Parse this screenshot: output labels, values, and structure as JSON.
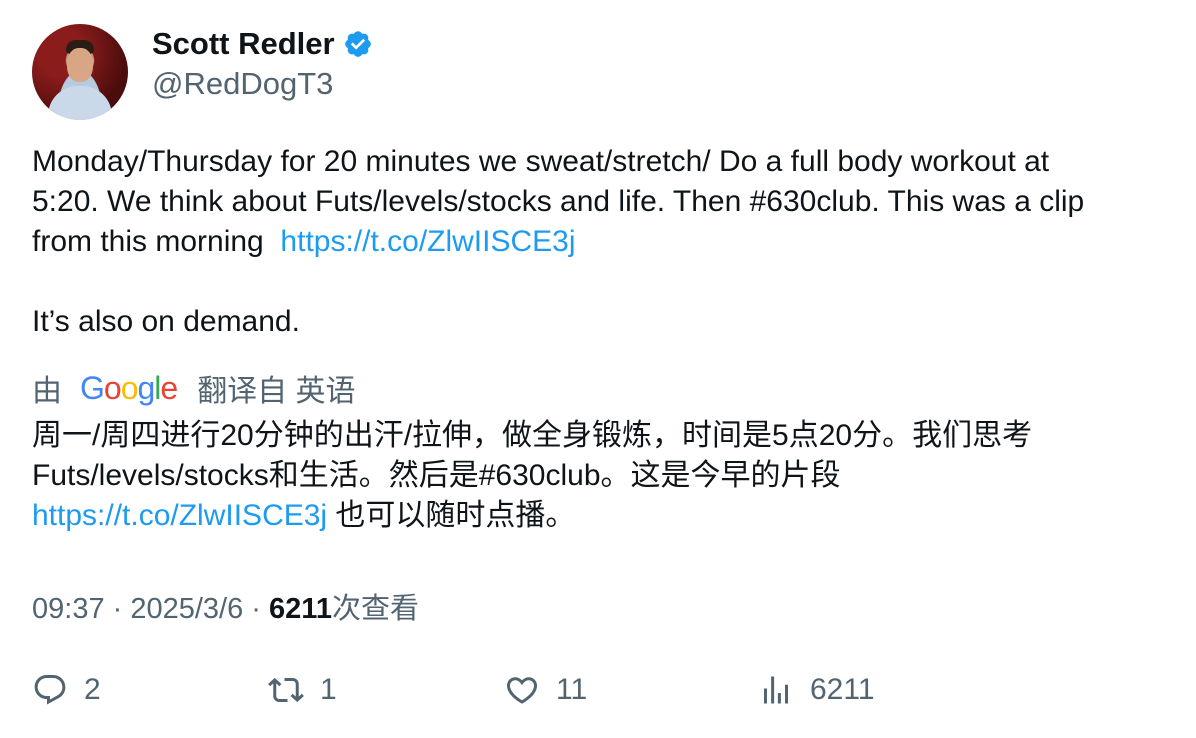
{
  "author": {
    "display_name": "Scott Redler",
    "handle": "@RedDogT3",
    "verified": true
  },
  "tweet": {
    "line1": "Monday/Thursday for 20 minutes we sweat/stretch/ Do a full body workout at",
    "line2": "5:20. We think about Futs/levels/stocks and life. Then #630club. This was a clip",
    "line3_text": "from this morning  ",
    "link": "https://t.co/ZlwIISCE3j",
    "line4": "It’s also on demand."
  },
  "translation": {
    "prefix": "由",
    "provider": "Google",
    "suffix": "翻译自 英语",
    "line1": "周一/周四进行20分钟的出汗/拉伸，做全身锻炼，时间是5点20分。我们思考",
    "line2": "Futs/levels/stocks和生活。然后是#630club。这是今早的片段",
    "link": "https://t.co/ZlwIISCE3j",
    "line3_rest": " 也可以随时点播。"
  },
  "meta": {
    "time": "09:37",
    "sep1": " · ",
    "date": "2025/3/6",
    "sep2": " · ",
    "views": "6211",
    "views_label": "次查看"
  },
  "actions": {
    "replies": "2",
    "retweets": "1",
    "likes": "11",
    "views": "6211"
  },
  "colors": {
    "accent": "#1d9bf0",
    "secondary_text": "#536471",
    "primary_text": "#0f1419"
  },
  "icons": [
    "verified-badge-icon",
    "reply-icon",
    "retweet-icon",
    "like-icon",
    "views-icon",
    "google-logo"
  ]
}
